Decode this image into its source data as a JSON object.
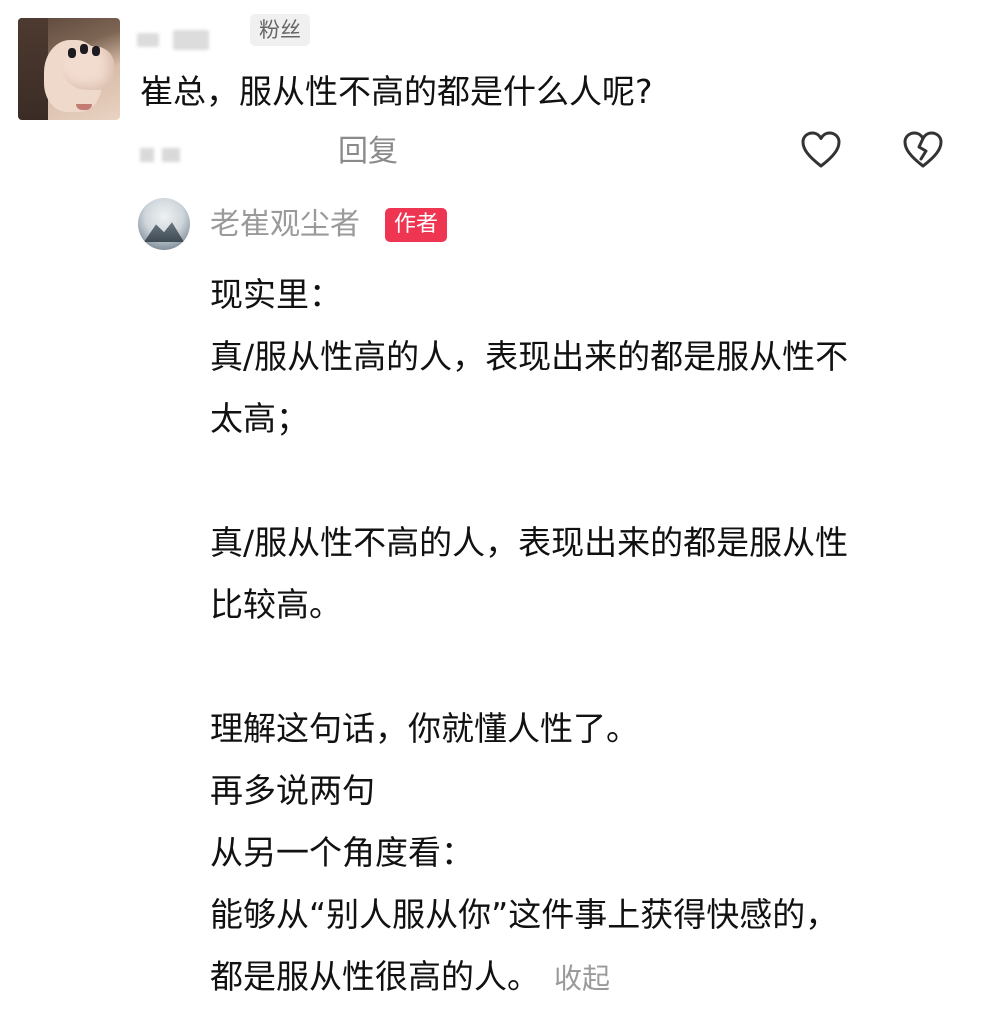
{
  "comment": {
    "badge": "粉丝",
    "text": "崔总，服从性不高的都是什么人呢?",
    "reply_label": "回复"
  },
  "icons": {
    "like": "heart-icon",
    "dislike": "broken-heart-icon"
  },
  "author_reply": {
    "name": "老崔观尘者",
    "badge": "作者",
    "lines": [
      "现实里：",
      "真/服从性高的人，表现出来的都是服从性不",
      "太高；",
      "",
      "真/服从性不高的人，表现出来的都是服从性",
      "比较高。",
      "",
      "理解这句话，你就懂人性了。",
      "再多说两句",
      "从另一个角度看：",
      "能够从“别人服从你”这件事上获得快感的，",
      "都是服从性很高的人。"
    ],
    "collapse_label": "收起"
  },
  "colors": {
    "author_badge": "#ee3551",
    "muted_text": "#9a9a9a"
  }
}
